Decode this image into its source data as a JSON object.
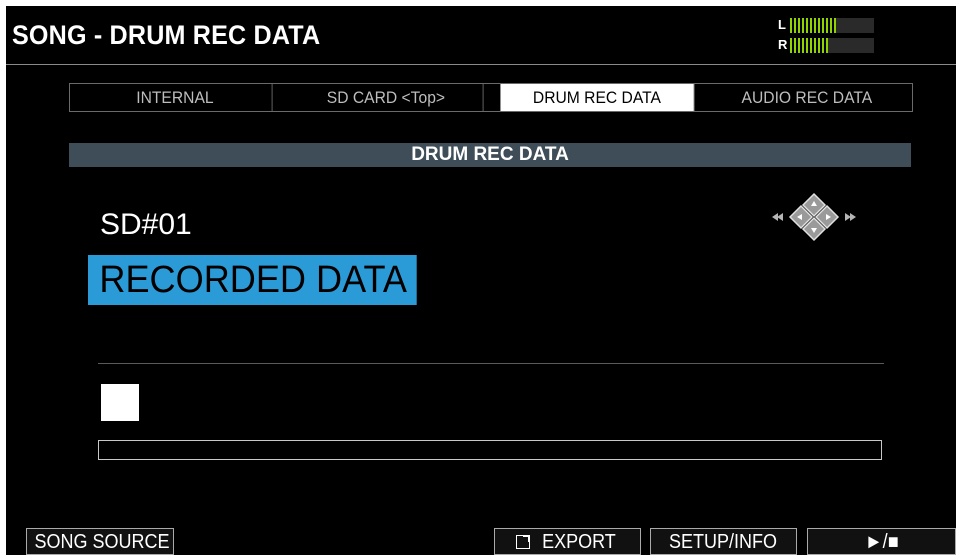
{
  "header": {
    "title": "SONG - DRUM REC DATA",
    "meter": {
      "left_label": "L",
      "right_label": "R",
      "left_level": 0.55,
      "right_level": 0.45,
      "color": "#8fd400"
    }
  },
  "tabs": [
    {
      "label": "INTERNAL",
      "active": false
    },
    {
      "label": "SD CARD <Top>",
      "active": false
    },
    {
      "label": "DRUM REC DATA",
      "active": true
    },
    {
      "label": "AUDIO REC DATA",
      "active": false
    }
  ],
  "section": {
    "title": "DRUM REC DATA"
  },
  "item": {
    "slot": "SD#01",
    "name": "RECORDED DATA",
    "highlight_color": "#2b9bd8"
  },
  "navigation": {
    "icon": "cursor-dpad-icon",
    "prev_icon": "rewind-icon",
    "next_icon": "fast-forward-icon"
  },
  "progress": {
    "value": 0
  },
  "function_buttons": {
    "song_source": "SONG SOURCE",
    "export": "EXPORT",
    "export_icon": "external-export-icon",
    "setup_info": "SETUP/INFO",
    "play_stop": "►/■"
  }
}
